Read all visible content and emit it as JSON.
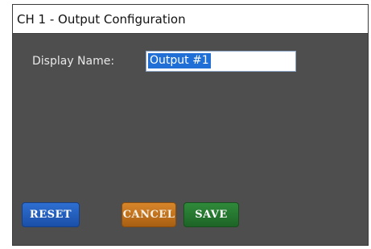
{
  "window": {
    "title": "CH 1 - Output Configuration"
  },
  "form": {
    "display_name_label": "Display Name:",
    "display_name_value": "Output #1"
  },
  "buttons": {
    "reset_label": "RESET",
    "cancel_label": "CANCEL",
    "save_label": "SAVE"
  },
  "colors": {
    "panel_background": "#4e4e4e",
    "reset_button": "#2e6fd1",
    "cancel_button": "#d8862a",
    "save_button": "#2f8a3a",
    "selection_highlight": "#1f6fd6"
  }
}
